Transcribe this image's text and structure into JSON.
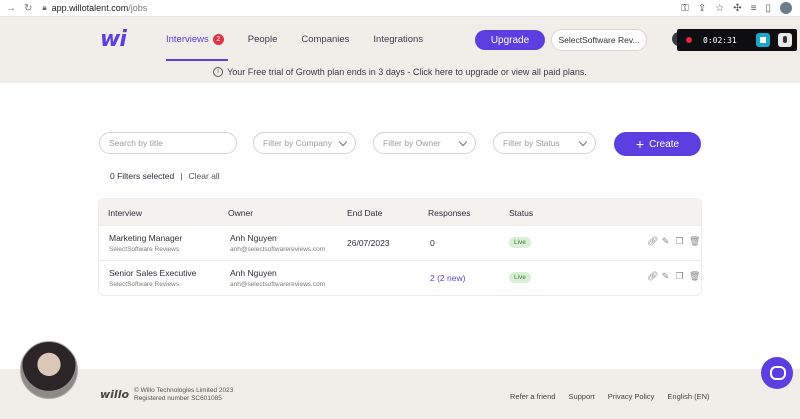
{
  "browser": {
    "url_host": "app.willotalent.com",
    "url_path": "/jobs"
  },
  "header": {
    "logo": "wi",
    "nav": [
      {
        "label": "Interviews",
        "badge": "2",
        "active": true
      },
      {
        "label": "People"
      },
      {
        "label": "Companies"
      },
      {
        "label": "Integrations"
      }
    ],
    "upgrade_label": "Upgrade",
    "company_select": "SelectSoftware Rev..."
  },
  "recording": {
    "time": "0:02:31"
  },
  "banner": {
    "text": "Your Free trial of Growth plan ends in 3 days - Click here to upgrade or view all paid plans."
  },
  "filters": {
    "search_placeholder": "Search by title",
    "company_placeholder": "Filter by Company",
    "owner_placeholder": "Filter by Owner",
    "status_placeholder": "Filter by Status",
    "create_label": "Create",
    "selected_text": "0 Filters selected",
    "separator": "|",
    "clear_all": "Clear all"
  },
  "table": {
    "headers": [
      "Interview",
      "Owner",
      "End Date",
      "Responses",
      "Status"
    ],
    "rows": [
      {
        "title": "Marketing Manager",
        "company": "SelectSoftware Reviews",
        "owner": "Anh Nguyen",
        "email": "anh@selectsoftwarereviews.com",
        "end_date": "26/07/2023",
        "responses": "0",
        "status": "Live"
      },
      {
        "title": "Senior Sales Executive",
        "company": "SelectSoftware Reviews",
        "owner": "Anh Nguyen",
        "email": "anh@selectsoftwarereviews.com",
        "end_date": "",
        "responses": "2 (2 new)",
        "status": "Live"
      }
    ]
  },
  "footer": {
    "logo": "willo",
    "copyright": "© Willo Technologies Limited 2023",
    "registration": "Registered number SC601085",
    "links": [
      "Refer a friend",
      "Support",
      "Privacy Policy",
      "English (EN)"
    ]
  },
  "colors": {
    "accent": "#5b3fe0",
    "live_bg": "#d9f0d6",
    "badge": "#e0334a"
  }
}
